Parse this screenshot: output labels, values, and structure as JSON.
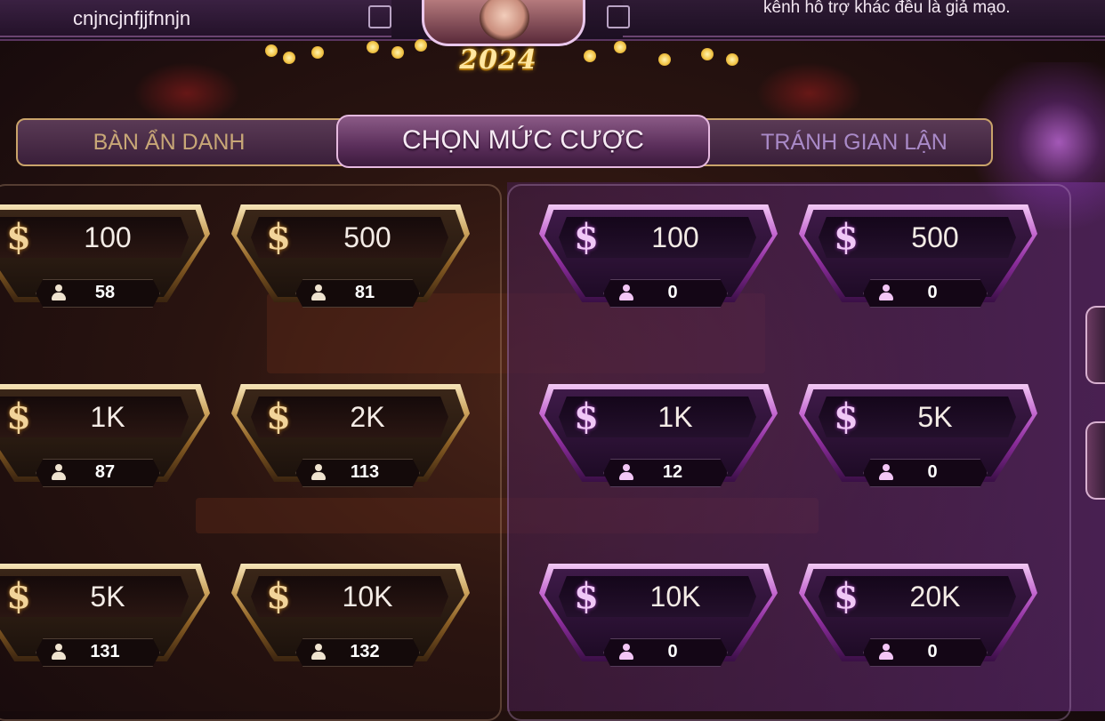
{
  "header": {
    "username": "cnjncjnfjjfnnjn",
    "notice": "kênh hỗ trợ khác đều là giả mạo.",
    "logo": "2024"
  },
  "tabs": [
    {
      "label": "BÀN ẨN DANH",
      "active": false
    },
    {
      "label": "CHỌN MỨC CƯỢC",
      "active": true
    },
    {
      "label": "TRÁNH GIAN LẬN",
      "active": false
    }
  ],
  "colors": {
    "gold_accent": "#c9a05a",
    "purple_accent": "#c468d0",
    "active_tab": "#8b5a86"
  },
  "icons": {
    "currency": "dollar-icon",
    "players": "user-icon"
  },
  "currency_symbol": "$",
  "left_tables": [
    {
      "value": "100",
      "players": "58"
    },
    {
      "value": "500",
      "players": "81"
    },
    {
      "value": "1K",
      "players": "87"
    },
    {
      "value": "2K",
      "players": "113"
    },
    {
      "value": "5K",
      "players": "131"
    },
    {
      "value": "10K",
      "players": "132"
    }
  ],
  "right_tables": [
    {
      "value": "100",
      "players": "0"
    },
    {
      "value": "500",
      "players": "0"
    },
    {
      "value": "1K",
      "players": "12"
    },
    {
      "value": "5K",
      "players": "0"
    },
    {
      "value": "10K",
      "players": "0"
    },
    {
      "value": "20K",
      "players": "0"
    }
  ]
}
